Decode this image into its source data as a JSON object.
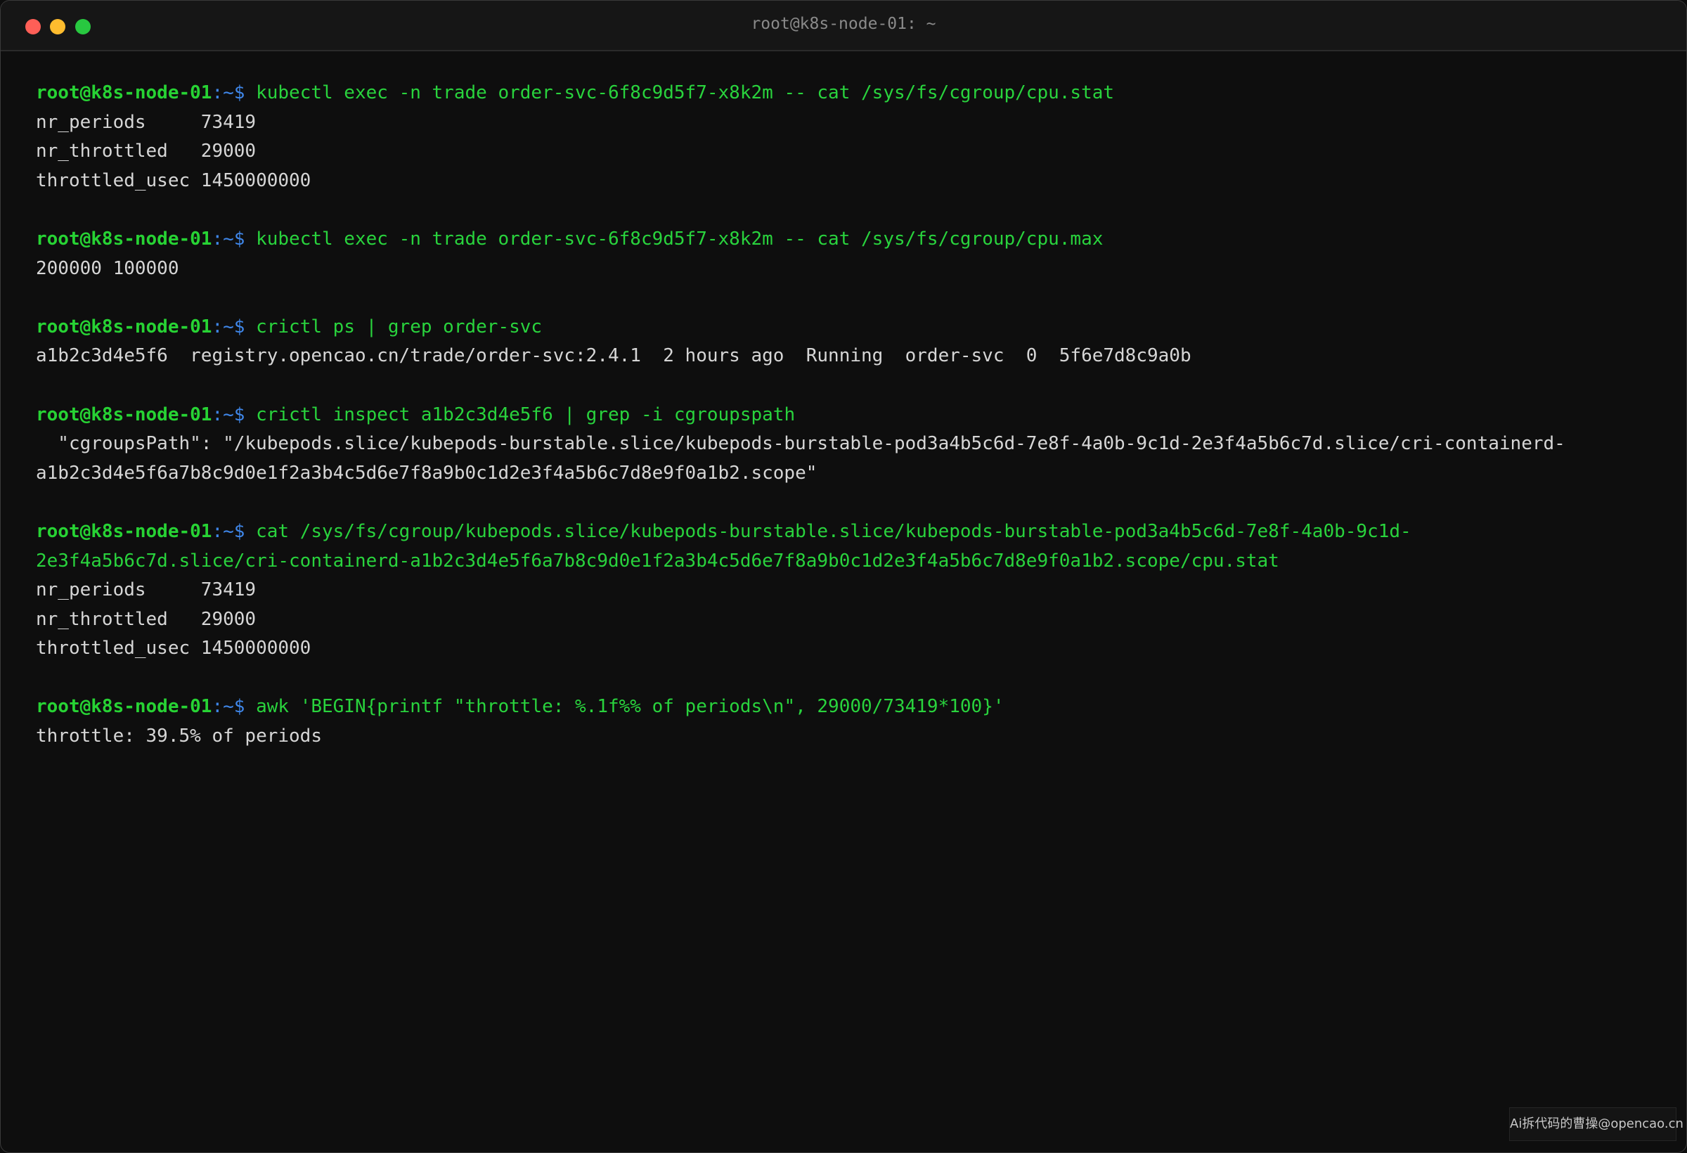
{
  "window": {
    "title": "root@k8s-node-01: ~"
  },
  "prompt": {
    "user_host": "root@k8s-node-01",
    "path": ":~",
    "symbol": "$"
  },
  "blocks": [
    {
      "command": "kubectl exec -n trade order-svc-6f8c9d5f7-x8k2m -- cat /sys/fs/cgroup/cpu.stat",
      "output": [
        "nr_periods     73419",
        "nr_throttled   29000",
        "throttled_usec 1450000000"
      ]
    },
    {
      "command": "kubectl exec -n trade order-svc-6f8c9d5f7-x8k2m -- cat /sys/fs/cgroup/cpu.max",
      "output": [
        "200000 100000"
      ]
    },
    {
      "command": "crictl ps | grep order-svc",
      "output": [
        "a1b2c3d4e5f6  registry.opencao.cn/trade/order-svc:2.4.1  2 hours ago  Running  order-svc  0  5f6e7d8c9a0b"
      ]
    },
    {
      "command": "crictl inspect a1b2c3d4e5f6 | grep -i cgroupspath",
      "output": [
        "  \"cgroupsPath\": \"/kubepods.slice/kubepods-burstable.slice/kubepods-burstable-pod3a4b5c6d-7e8f-4a0b-9c1d-2e3f4a5b6c7d.slice/cri-containerd-",
        "a1b2c3d4e5f6a7b8c9d0e1f2a3b4c5d6e7f8a9b0c1d2e3f4a5b6c7d8e9f0a1b2.scope\""
      ]
    },
    {
      "command": "cat /sys/fs/cgroup/kubepods.slice/kubepods-burstable.slice/kubepods-burstable-pod3a4b5c6d-7e8f-4a0b-9c1d-",
      "command_cont": "2e3f4a5b6c7d.slice/cri-containerd-a1b2c3d4e5f6a7b8c9d0e1f2a3b4c5d6e7f8a9b0c1d2e3f4a5b6c7d8e9f0a1b2.scope/cpu.stat",
      "output": [
        "nr_periods     73419",
        "nr_throttled   29000",
        "throttled_usec 1450000000"
      ]
    },
    {
      "command": "awk 'BEGIN{printf \"throttle: %.1f%% of periods\\n\", 29000/73419*100}'",
      "output": [
        "throttle: 39.5% of periods"
      ]
    }
  ],
  "watermark": "Ai拆代码的曹操@opencao.cn",
  "colors": {
    "background": "#0e0e0e",
    "prompt_user": "#27d334",
    "prompt_path": "#3f86e8",
    "command": "#29d33d",
    "output": "#d6d6d6"
  }
}
